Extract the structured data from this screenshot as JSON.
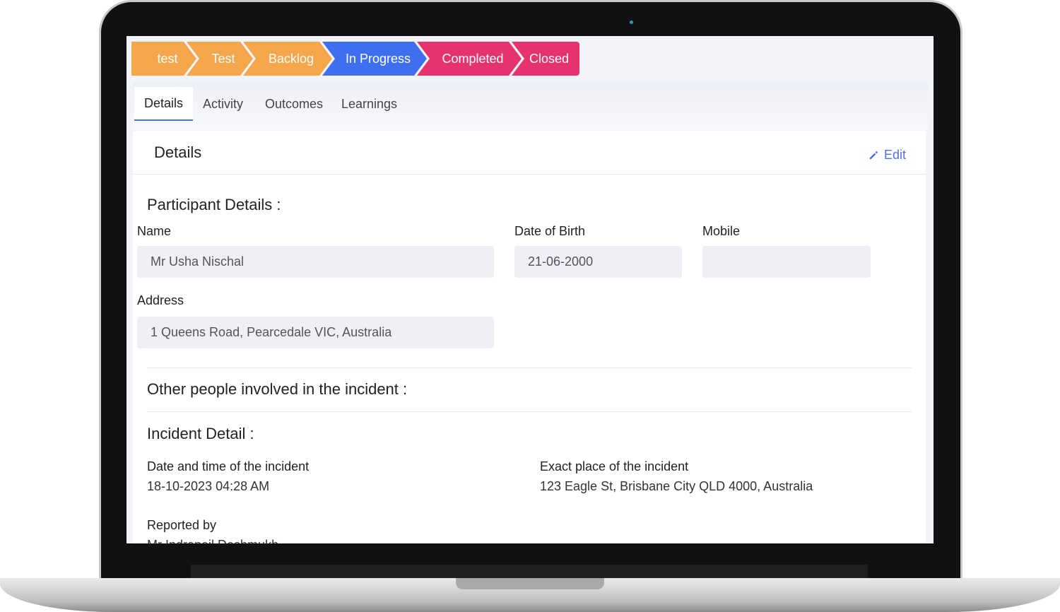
{
  "stages": [
    {
      "label": "test",
      "color": "#f5a64a"
    },
    {
      "label": "Test",
      "color": "#f5a64a"
    },
    {
      "label": "Backlog",
      "color": "#f5a64a"
    },
    {
      "label": "In Progress",
      "color": "#3f6ff0"
    },
    {
      "label": "Completed",
      "color": "#e6336d"
    },
    {
      "label": "Closed",
      "color": "#e6336d"
    }
  ],
  "tabs": [
    {
      "label": "Details",
      "active": true
    },
    {
      "label": "Activity",
      "active": false
    },
    {
      "label": "Outcomes",
      "active": false
    },
    {
      "label": "Learnings",
      "active": false
    }
  ],
  "card": {
    "title": "Details",
    "edit_label": "Edit",
    "accent_color": "#4c6ef5"
  },
  "participant": {
    "section_title": "Participant Details :",
    "name_label": "Name",
    "name_value": "Mr Usha Nischal",
    "dob_label": "Date of Birth",
    "dob_value": "21-06-2000",
    "mobile_label": "Mobile",
    "mobile_value": "",
    "address_label": "Address",
    "address_value": "1 Queens Road, Pearcedale VIC, Australia"
  },
  "others": {
    "section_title": "Other people involved in the incident :"
  },
  "incident": {
    "section_title": "Incident Detail :",
    "datetime_label": "Date and time of the incident",
    "datetime_value": "18-10-2023 04:28 AM",
    "place_label": "Exact place of the incident",
    "place_value": "123 Eagle St, Brisbane City QLD 4000, Australia",
    "reported_label": "Reported by",
    "reported_value": "Mr Indraneil Deshmukh"
  }
}
